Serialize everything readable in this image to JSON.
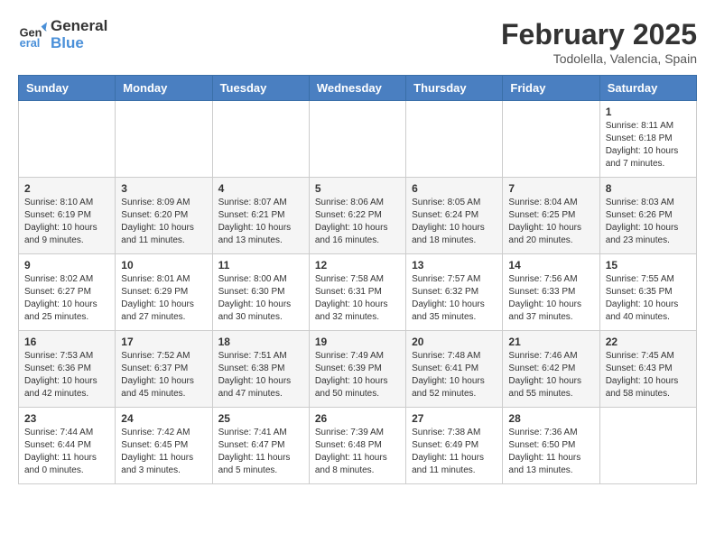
{
  "header": {
    "logo_line1": "General",
    "logo_line2": "Blue",
    "month": "February 2025",
    "location": "Todolella, Valencia, Spain"
  },
  "days_of_week": [
    "Sunday",
    "Monday",
    "Tuesday",
    "Wednesday",
    "Thursday",
    "Friday",
    "Saturday"
  ],
  "weeks": [
    [
      {
        "day": "",
        "info": ""
      },
      {
        "day": "",
        "info": ""
      },
      {
        "day": "",
        "info": ""
      },
      {
        "day": "",
        "info": ""
      },
      {
        "day": "",
        "info": ""
      },
      {
        "day": "",
        "info": ""
      },
      {
        "day": "1",
        "info": "Sunrise: 8:11 AM\nSunset: 6:18 PM\nDaylight: 10 hours\nand 7 minutes."
      }
    ],
    [
      {
        "day": "2",
        "info": "Sunrise: 8:10 AM\nSunset: 6:19 PM\nDaylight: 10 hours\nand 9 minutes."
      },
      {
        "day": "3",
        "info": "Sunrise: 8:09 AM\nSunset: 6:20 PM\nDaylight: 10 hours\nand 11 minutes."
      },
      {
        "day": "4",
        "info": "Sunrise: 8:07 AM\nSunset: 6:21 PM\nDaylight: 10 hours\nand 13 minutes."
      },
      {
        "day": "5",
        "info": "Sunrise: 8:06 AM\nSunset: 6:22 PM\nDaylight: 10 hours\nand 16 minutes."
      },
      {
        "day": "6",
        "info": "Sunrise: 8:05 AM\nSunset: 6:24 PM\nDaylight: 10 hours\nand 18 minutes."
      },
      {
        "day": "7",
        "info": "Sunrise: 8:04 AM\nSunset: 6:25 PM\nDaylight: 10 hours\nand 20 minutes."
      },
      {
        "day": "8",
        "info": "Sunrise: 8:03 AM\nSunset: 6:26 PM\nDaylight: 10 hours\nand 23 minutes."
      }
    ],
    [
      {
        "day": "9",
        "info": "Sunrise: 8:02 AM\nSunset: 6:27 PM\nDaylight: 10 hours\nand 25 minutes."
      },
      {
        "day": "10",
        "info": "Sunrise: 8:01 AM\nSunset: 6:29 PM\nDaylight: 10 hours\nand 27 minutes."
      },
      {
        "day": "11",
        "info": "Sunrise: 8:00 AM\nSunset: 6:30 PM\nDaylight: 10 hours\nand 30 minutes."
      },
      {
        "day": "12",
        "info": "Sunrise: 7:58 AM\nSunset: 6:31 PM\nDaylight: 10 hours\nand 32 minutes."
      },
      {
        "day": "13",
        "info": "Sunrise: 7:57 AM\nSunset: 6:32 PM\nDaylight: 10 hours\nand 35 minutes."
      },
      {
        "day": "14",
        "info": "Sunrise: 7:56 AM\nSunset: 6:33 PM\nDaylight: 10 hours\nand 37 minutes."
      },
      {
        "day": "15",
        "info": "Sunrise: 7:55 AM\nSunset: 6:35 PM\nDaylight: 10 hours\nand 40 minutes."
      }
    ],
    [
      {
        "day": "16",
        "info": "Sunrise: 7:53 AM\nSunset: 6:36 PM\nDaylight: 10 hours\nand 42 minutes."
      },
      {
        "day": "17",
        "info": "Sunrise: 7:52 AM\nSunset: 6:37 PM\nDaylight: 10 hours\nand 45 minutes."
      },
      {
        "day": "18",
        "info": "Sunrise: 7:51 AM\nSunset: 6:38 PM\nDaylight: 10 hours\nand 47 minutes."
      },
      {
        "day": "19",
        "info": "Sunrise: 7:49 AM\nSunset: 6:39 PM\nDaylight: 10 hours\nand 50 minutes."
      },
      {
        "day": "20",
        "info": "Sunrise: 7:48 AM\nSunset: 6:41 PM\nDaylight: 10 hours\nand 52 minutes."
      },
      {
        "day": "21",
        "info": "Sunrise: 7:46 AM\nSunset: 6:42 PM\nDaylight: 10 hours\nand 55 minutes."
      },
      {
        "day": "22",
        "info": "Sunrise: 7:45 AM\nSunset: 6:43 PM\nDaylight: 10 hours\nand 58 minutes."
      }
    ],
    [
      {
        "day": "23",
        "info": "Sunrise: 7:44 AM\nSunset: 6:44 PM\nDaylight: 11 hours\nand 0 minutes."
      },
      {
        "day": "24",
        "info": "Sunrise: 7:42 AM\nSunset: 6:45 PM\nDaylight: 11 hours\nand 3 minutes."
      },
      {
        "day": "25",
        "info": "Sunrise: 7:41 AM\nSunset: 6:47 PM\nDaylight: 11 hours\nand 5 minutes."
      },
      {
        "day": "26",
        "info": "Sunrise: 7:39 AM\nSunset: 6:48 PM\nDaylight: 11 hours\nand 8 minutes."
      },
      {
        "day": "27",
        "info": "Sunrise: 7:38 AM\nSunset: 6:49 PM\nDaylight: 11 hours\nand 11 minutes."
      },
      {
        "day": "28",
        "info": "Sunrise: 7:36 AM\nSunset: 6:50 PM\nDaylight: 11 hours\nand 13 minutes."
      },
      {
        "day": "",
        "info": ""
      }
    ]
  ]
}
